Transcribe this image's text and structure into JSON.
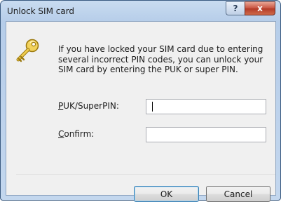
{
  "window": {
    "title": "Unlock SIM card",
    "help_glyph": "?",
    "close_glyph": "x"
  },
  "icon": "key-icon",
  "message": "If you have locked your SIM card due to entering several incorrect PIN codes, you can unlock your SIM card by entering the PUK or super PIN.",
  "fields": {
    "puk": {
      "label_mnemonic": "P",
      "label_rest": "UK/SuperPIN:",
      "value": ""
    },
    "confirm": {
      "label_mnemonic": "C",
      "label_rest": "onfirm:",
      "value": ""
    }
  },
  "buttons": {
    "ok": "OK",
    "cancel": "Cancel"
  },
  "colors": {
    "frame": "#b6cde9",
    "close_button": "#c8523f",
    "default_button_border": "#3c7fb1"
  }
}
